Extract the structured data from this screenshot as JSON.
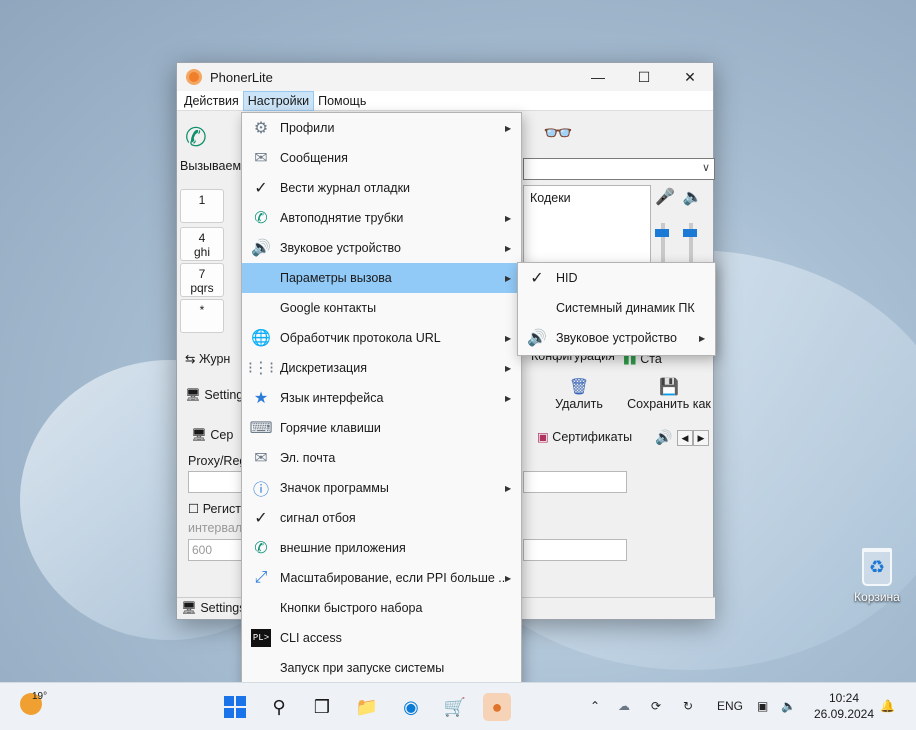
{
  "window": {
    "title": "PhonerLite",
    "controls": {
      "minimize": "—",
      "maximize": "☐",
      "close": "✕"
    }
  },
  "menubar": [
    "Действия",
    "Настройки",
    "Помощь"
  ],
  "main": {
    "callee_label": "Вызываемы",
    "codecs_label": "Кодеки",
    "journal_tab": "Журн",
    "settings_left": "Setting",
    "settings_bottom": "Settings",
    "server_tab": "Сер",
    "proxy_label": "Proxy/Reg",
    "register_label": "Регистр",
    "interval_label": "интервал",
    "interval_value": "600",
    "config_tab": "Конфигурация",
    "stat_tab": "Ста",
    "delete_label": "Удалить",
    "save_as_label": "Сохранить как",
    "certs_tab": "Сертификаты",
    "keys": [
      {
        "top": "1",
        "bottom": ""
      },
      {
        "top": "4",
        "bottom": "ghi"
      },
      {
        "top": "7",
        "bottom": "pqrs"
      },
      {
        "top": "*",
        "bottom": ""
      }
    ]
  },
  "settings_menu": {
    "items": [
      {
        "label": "Профили",
        "icon": "gear-icon",
        "submenu": true
      },
      {
        "label": "Сообщения",
        "icon": "envelope-icon",
        "submenu": false
      },
      {
        "label": "Вести журнал отладки",
        "icon": "check-icon",
        "submenu": false
      },
      {
        "label": "Автоподнятие трубки",
        "icon": "phone-hourglass-icon",
        "submenu": true
      },
      {
        "label": "Звуковое устройство",
        "icon": "speaker-icon",
        "submenu": true
      },
      {
        "label": "Параметры вызова",
        "icon": "",
        "submenu": true,
        "highlighted": true
      },
      {
        "label": "Google контакты",
        "icon": "",
        "submenu": false
      },
      {
        "label": "Обработчик протокола URL",
        "icon": "globe-icon",
        "submenu": true
      },
      {
        "label": "Дискретизация",
        "icon": "waveform-icon",
        "submenu": true
      },
      {
        "label": "Язык интерфейса",
        "icon": "language-icon",
        "submenu": true
      },
      {
        "label": "Горячие клавиши",
        "icon": "keyboard-icon",
        "submenu": false
      },
      {
        "label": "Эл. почта",
        "icon": "mail-icon",
        "submenu": false
      },
      {
        "label": "Значок программы",
        "icon": "info-icon",
        "submenu": true
      },
      {
        "label": "сигнал отбоя",
        "icon": "check-icon",
        "submenu": false
      },
      {
        "label": "внешние приложения",
        "icon": "phone-icon",
        "submenu": false
      },
      {
        "label": "Масштабирование, если PPI больше ...",
        "icon": "scale-icon",
        "submenu": true
      },
      {
        "label": "Кнопки быстрого набора",
        "icon": "",
        "submenu": false
      },
      {
        "label": "CLI access",
        "icon": "terminal-icon",
        "submenu": false
      },
      {
        "label": "Запуск при запуске системы",
        "icon": "",
        "submenu": false
      }
    ]
  },
  "call_params_submenu": {
    "items": [
      {
        "label": "HID",
        "checked": true
      },
      {
        "label": "Системный динамик ПК",
        "checked": false
      },
      {
        "label": "Звуковое устройство",
        "checked": false,
        "submenu": true
      }
    ]
  },
  "desktop": {
    "recycle_bin": "Корзина"
  },
  "taskbar": {
    "temperature": "19°",
    "language": "ENG",
    "time": "10:24",
    "date": "26.09.2024"
  }
}
